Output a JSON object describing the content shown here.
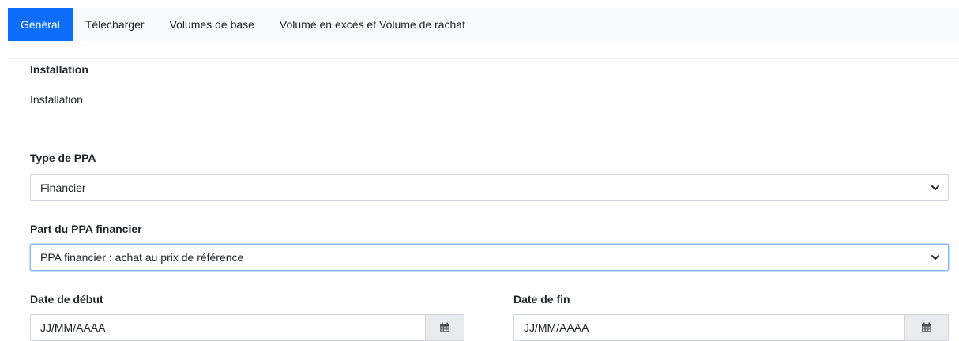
{
  "tabs": [
    {
      "label": "Général",
      "active": true
    },
    {
      "label": "Télecharger",
      "active": false
    },
    {
      "label": "Volumes de base",
      "active": false
    },
    {
      "label": "Volume en excès et Volume de rachat",
      "active": false
    }
  ],
  "installation": {
    "label": "Installation",
    "value": "Installation"
  },
  "ppa_type": {
    "label": "Type de PPA",
    "selected": "Financier"
  },
  "ppa_part": {
    "label": "Part du PPA financier",
    "selected": "PPA financier : achat au prix de référence"
  },
  "start_date": {
    "label": "Date de début",
    "placeholder": "JJ/MM/AAAA"
  },
  "end_date": {
    "label": "Date de fin",
    "placeholder": "JJ/MM/AAAA"
  },
  "colors": {
    "accent": "#0d6efd",
    "tab_bg": "#f8f9fa",
    "border": "#ced4da",
    "addon_bg": "#e9ecef"
  },
  "icons": {
    "chevron": "chevron-down-icon",
    "calendar": "calendar-icon"
  }
}
